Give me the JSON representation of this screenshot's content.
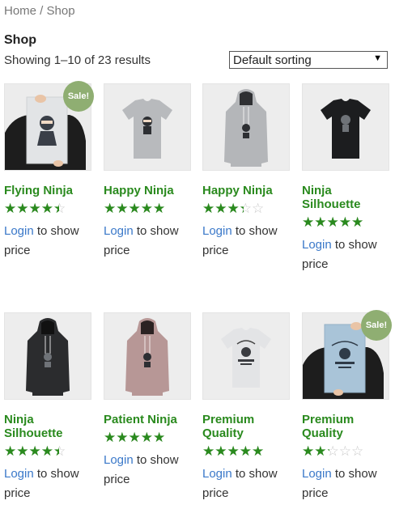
{
  "breadcrumb": {
    "home": "Home",
    "sep": " / ",
    "current": "Shop"
  },
  "page_title": "Shop",
  "result_count": "Showing 1–10 of 23 results",
  "sorting": {
    "selected": "Default sorting"
  },
  "products": [
    {
      "title": "Flying Ninja",
      "rating": 4,
      "sale": "Sale!",
      "login": "Login",
      "price_text": " to show price"
    },
    {
      "title": "Happy Ninja",
      "rating": 5,
      "sale": "",
      "login": "Login",
      "price_text": " to show price"
    },
    {
      "title": "Happy Ninja",
      "rating": 3,
      "sale": "",
      "login": "Login",
      "price_text": " to show price"
    },
    {
      "title": "Ninja Silhouette",
      "rating": 5,
      "sale": "",
      "login": "Login",
      "price_text": " to show price"
    },
    {
      "title": "Ninja Silhouette",
      "rating": 4,
      "sale": "",
      "login": "Login",
      "price_text": " to show price"
    },
    {
      "title": "Patient Ninja",
      "rating": 4.6,
      "sale": "",
      "login": "Login",
      "price_text": " to show price"
    },
    {
      "title": "Premium Quality",
      "rating": 4.5,
      "sale": "",
      "login": "Login",
      "price_text": " to show price"
    },
    {
      "title": "Premium Quality",
      "rating": 2,
      "sale": "Sale!",
      "login": "Login",
      "price_text": " to show price"
    }
  ],
  "colors": {
    "accent": "#2a8a1e",
    "link": "#3a78c9",
    "sale_badge": "#8fae72",
    "star_empty": "#c9c9c9"
  },
  "icons": {
    "star": "star-icon",
    "dropdown": "chevron-down-icon"
  }
}
